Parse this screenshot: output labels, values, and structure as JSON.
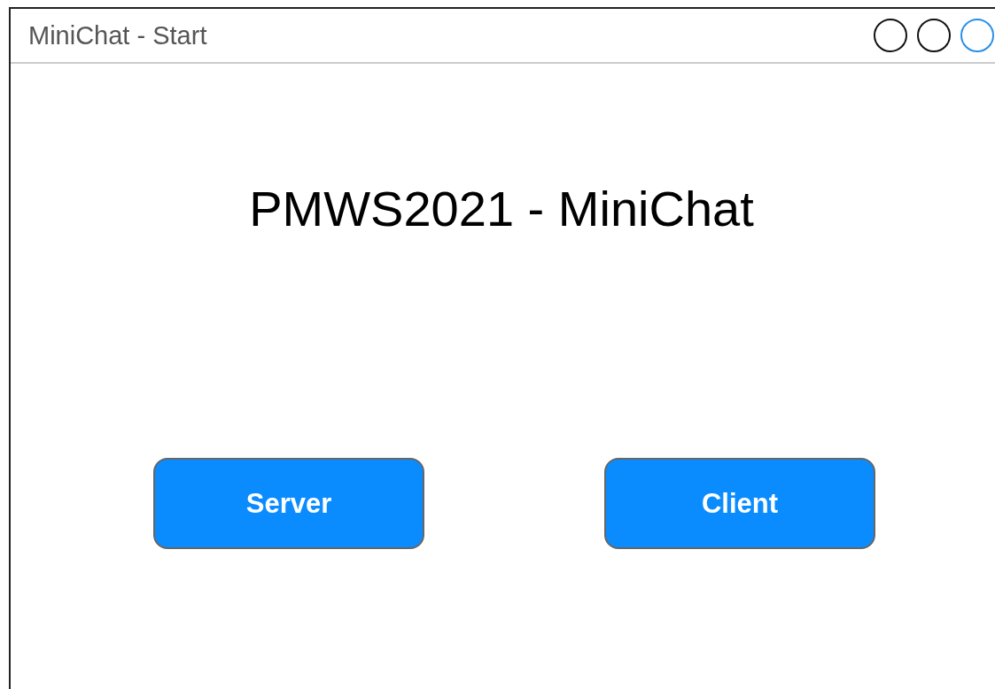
{
  "window": {
    "title": "MiniChat - Start"
  },
  "heading": "PMWS2021 - MiniChat",
  "buttons": [
    "Server",
    "Client"
  ]
}
